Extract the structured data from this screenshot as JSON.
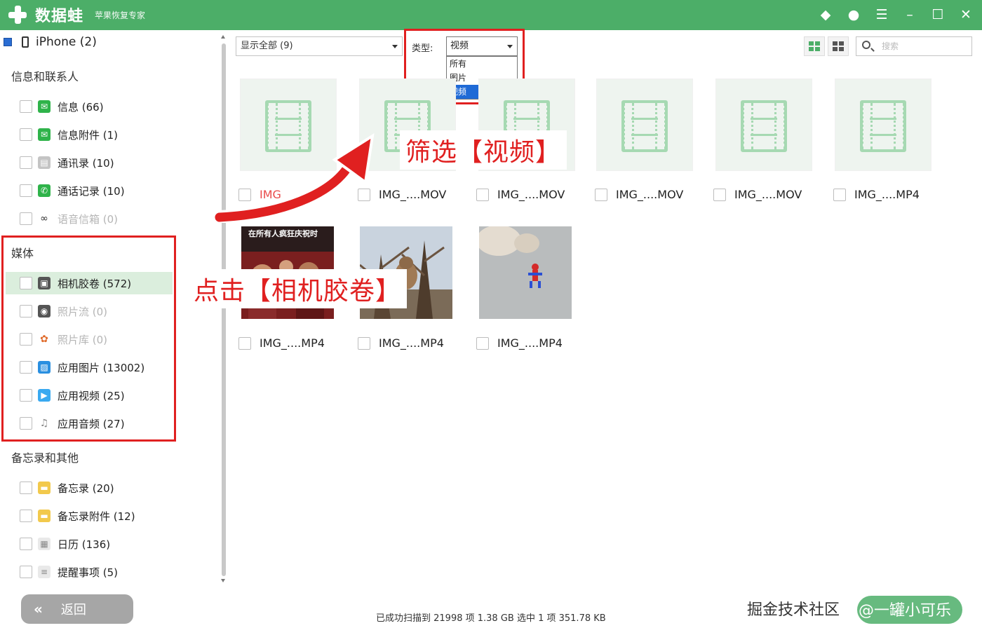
{
  "app": {
    "name": "数据蛙",
    "subtitle": "苹果恢复专家"
  },
  "titlebar_icons": [
    "diamond-icon",
    "chat-icon",
    "menu-icon",
    "minimize-icon",
    "maximize-icon",
    "close-icon"
  ],
  "device": {
    "label": "iPhone (2)"
  },
  "sidebar": {
    "sections": [
      {
        "title": "信息和联系人",
        "items": [
          {
            "label": "信息 (66)",
            "icon": "message-icon"
          },
          {
            "label": "信息附件 (1)",
            "icon": "message-attachment-icon"
          },
          {
            "label": "通讯录 (10)",
            "icon": "contacts-icon"
          },
          {
            "label": "通话记录 (10)",
            "icon": "phone-icon"
          },
          {
            "label": "语音信箱 (0)",
            "icon": "voicemail-icon"
          }
        ]
      },
      {
        "title": "媒体",
        "items": [
          {
            "label": "相机胶卷 (572)",
            "icon": "camera-roll-icon"
          },
          {
            "label": "照片流 (0)",
            "icon": "photo-stream-icon"
          },
          {
            "label": "照片库 (0)",
            "icon": "photo-library-icon"
          },
          {
            "label": "应用图片 (13002)",
            "icon": "app-photos-icon"
          },
          {
            "label": "应用视频 (25)",
            "icon": "app-videos-icon"
          },
          {
            "label": "应用音频 (27)",
            "icon": "app-audio-icon"
          }
        ]
      },
      {
        "title": "备忘录和其他",
        "items": [
          {
            "label": "备忘录 (20)",
            "icon": "notes-icon"
          },
          {
            "label": "备忘录附件 (12)",
            "icon": "notes-attachment-icon"
          },
          {
            "label": "日历 (136)",
            "icon": "calendar-icon"
          },
          {
            "label": "提醒事项 (5)",
            "icon": "reminders-icon"
          }
        ]
      }
    ]
  },
  "toolbar": {
    "filter_value": "显示全部 (9)",
    "type_label": "类型:",
    "type_value": "视频",
    "type_options": [
      "所有",
      "图片",
      "视频"
    ],
    "search_placeholder": "搜索"
  },
  "files": [
    {
      "name": "IMG",
      "kind": "video"
    },
    {
      "name": "IMG_....MOV",
      "kind": "video"
    },
    {
      "name": "IMG_....MOV",
      "kind": "video"
    },
    {
      "name": "IMG_....MOV",
      "kind": "video"
    },
    {
      "name": "IMG_....MOV",
      "kind": "video"
    },
    {
      "name": "IMG_....MP4",
      "kind": "video"
    },
    {
      "name": "IMG_....MP4",
      "kind": "photo",
      "overlay_text": "在所有人疯狂庆祝时"
    },
    {
      "name": "IMG_....MP4",
      "kind": "photo"
    },
    {
      "name": "IMG_....MP4",
      "kind": "photo"
    }
  ],
  "annotations": {
    "filter": "筛选【视频】",
    "camera_roll": "点击【相机胶卷】"
  },
  "back_button": {
    "label": "返回"
  },
  "status": {
    "text": "已成功扫描到 21998 项 1.38 GB  选中 1 项 351.78 KB"
  },
  "watermark": {
    "text": "掘金技术社区",
    "handle": "@一罐小可乐"
  },
  "colors": {
    "brand": "#4cae68",
    "annotation": "#e02020",
    "selected_row": "#dbeedd"
  }
}
